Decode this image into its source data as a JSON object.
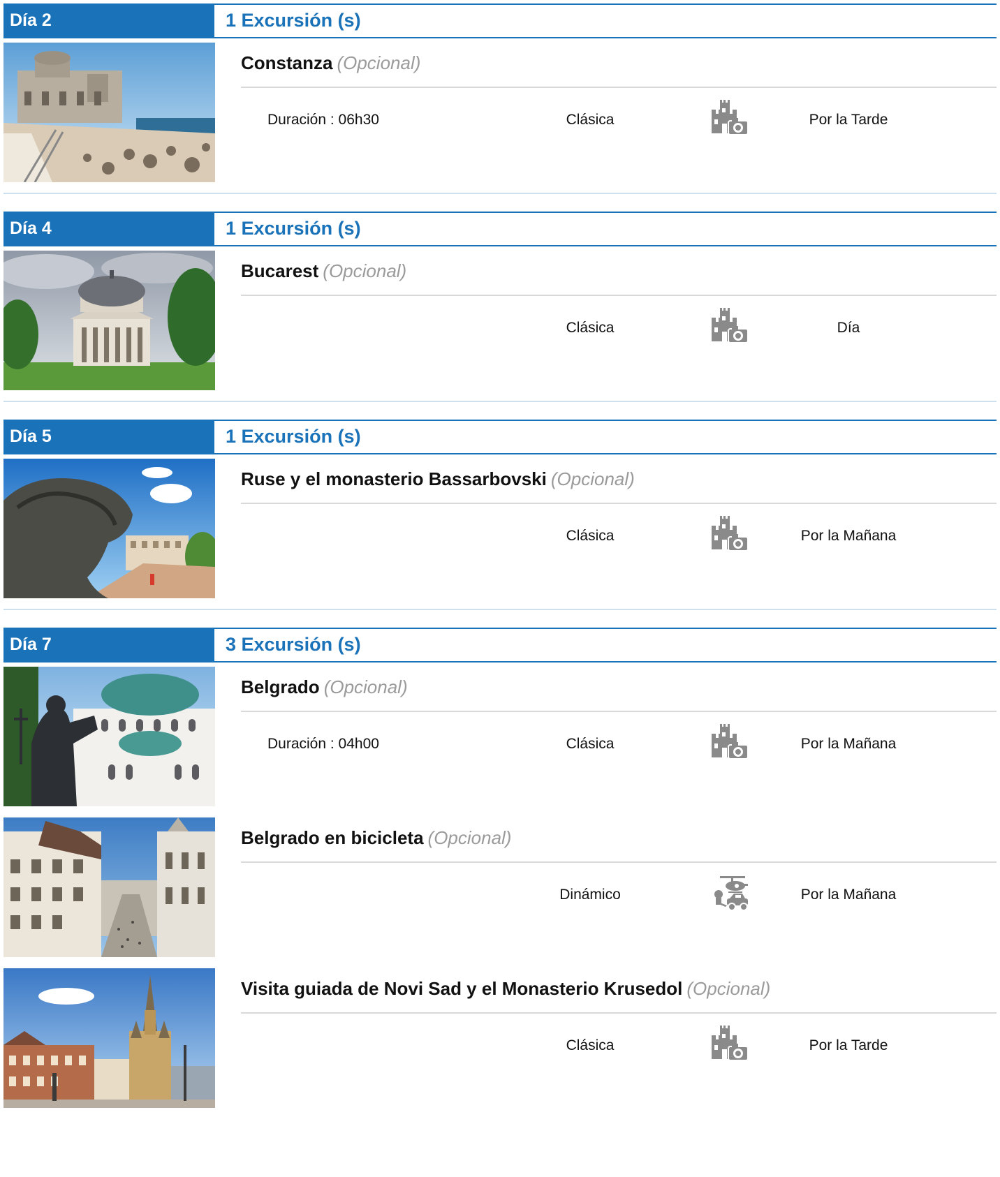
{
  "days": [
    {
      "label": "Día 2",
      "count_label": "1 Excursión (s)",
      "excursions": [
        {
          "title": "Constanza",
          "optional": "(Opcional)",
          "duration": "Duración : 06h30",
          "type": "Clásica",
          "icon": "castle-camera-icon",
          "time": "Por la Tarde",
          "photo": "casino-seaside"
        }
      ]
    },
    {
      "label": "Día 4",
      "count_label": "1 Excursión (s)",
      "excursions": [
        {
          "title": "Bucarest",
          "optional": "(Opcional)",
          "duration": "",
          "type": "Clásica",
          "icon": "castle-camera-icon",
          "time": "Día",
          "photo": "domed-athenaeum"
        }
      ]
    },
    {
      "label": "Día 5",
      "count_label": "1 Excursión (s)",
      "excursions": [
        {
          "title": "Ruse y el monasterio Bassarbovski",
          "optional": "(Opcional)",
          "duration": "",
          "type": "Clásica",
          "icon": "castle-camera-icon",
          "time": "Por la Mañana",
          "photo": "lion-statue-square"
        }
      ]
    },
    {
      "label": "Día 7",
      "count_label": "3 Excursión (s)",
      "excursions": [
        {
          "title": "Belgrado",
          "optional": "(Opcional)",
          "duration": "Duración : 04h00",
          "type": "Clásica",
          "icon": "castle-camera-icon",
          "time": "Por la Mañana",
          "photo": "cathedral-statue"
        },
        {
          "title": "Belgrado en bicicleta",
          "optional": "(Opcional)",
          "duration": "",
          "type": "Dinámico",
          "icon": "helicopter-car-icon",
          "time": "Por la Mañana",
          "photo": "city-street"
        },
        {
          "title": "Visita guiada de Novi Sad y el Monasterio Krusedol",
          "optional": "(Opcional)",
          "duration": "",
          "type": "Clásica",
          "icon": "castle-camera-icon",
          "time": "Por la Tarde",
          "photo": "gothic-church-square"
        }
      ]
    }
  ]
}
